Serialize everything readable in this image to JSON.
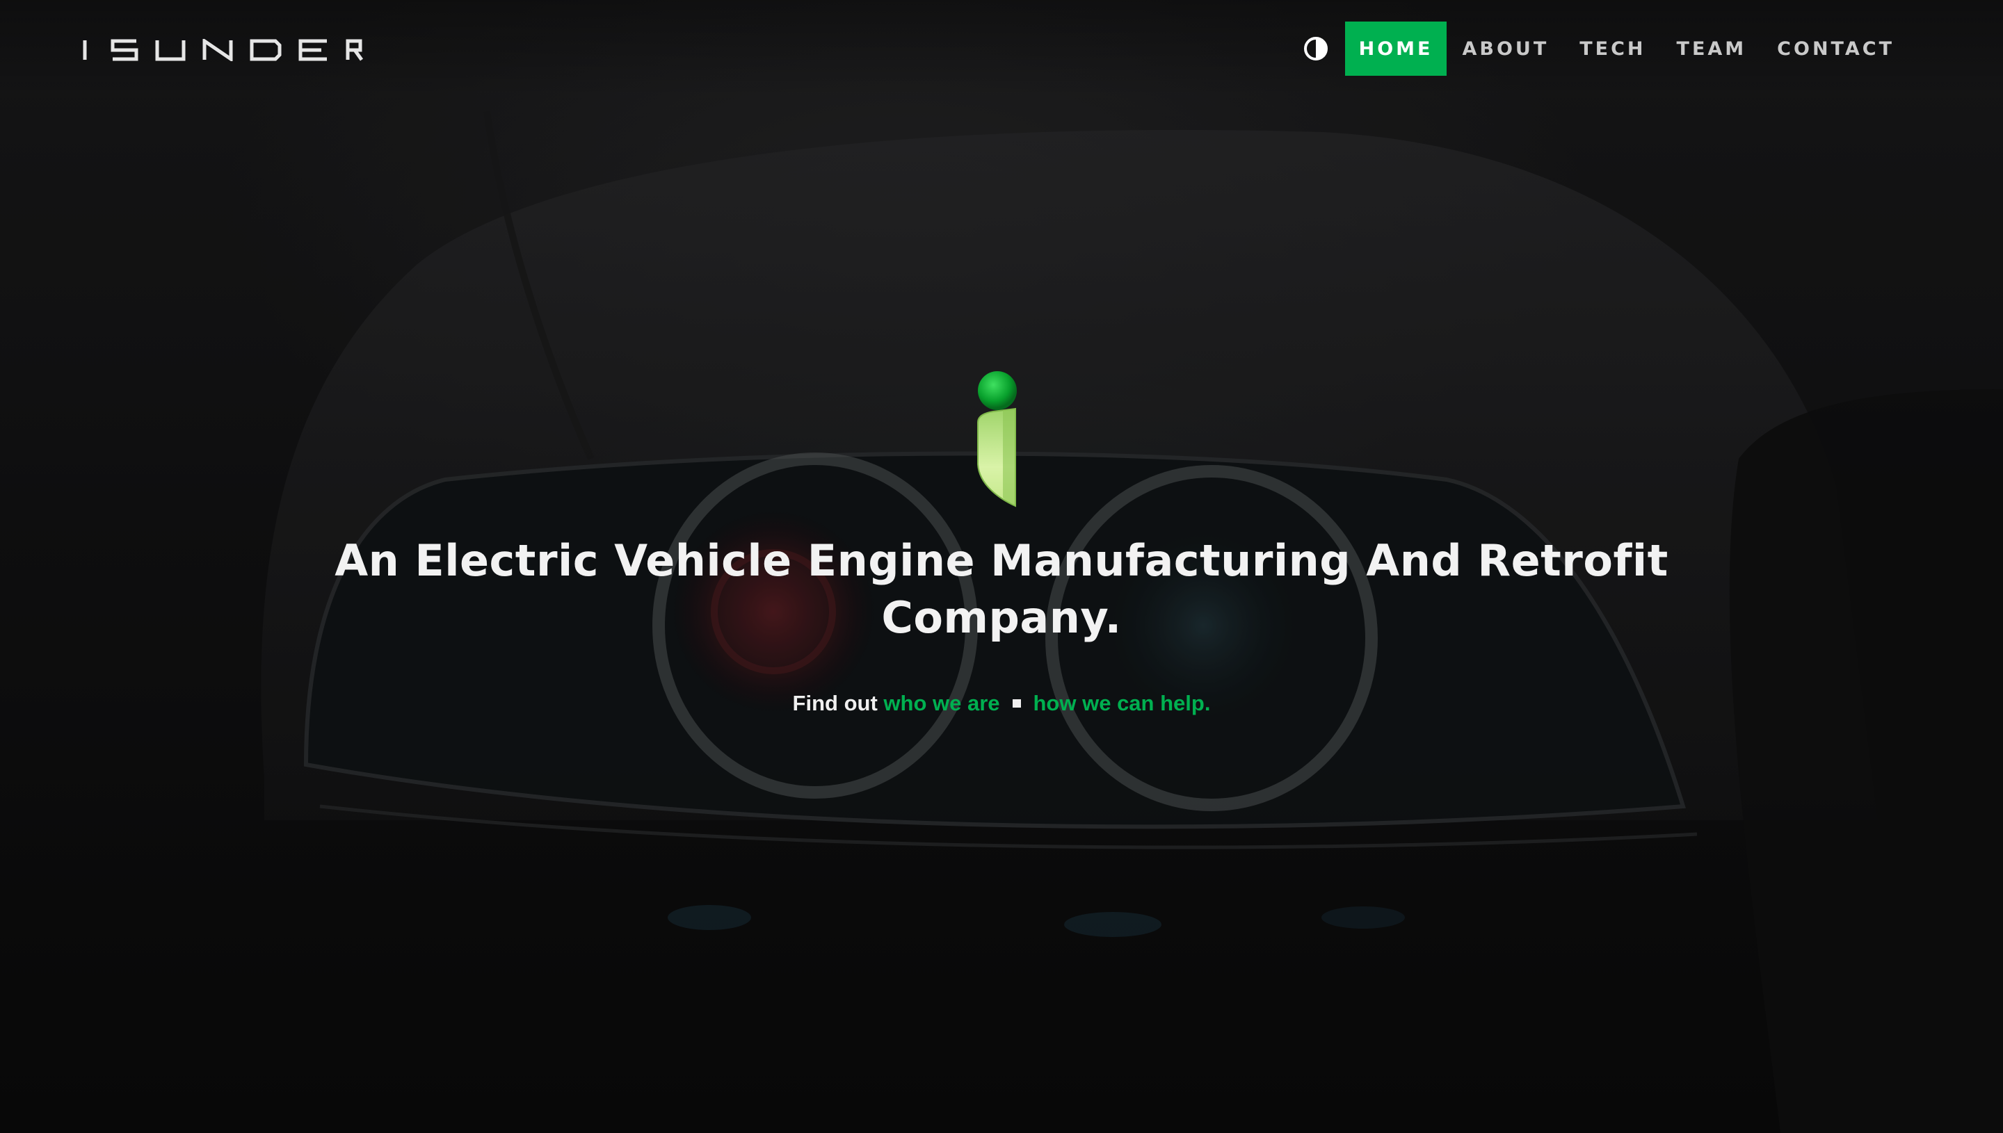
{
  "brand": {
    "logo_text": "ISUNDER",
    "accent_color": "#00b050"
  },
  "nav": {
    "theme_toggle_icon": "contrast-icon",
    "items": [
      {
        "label": "HOME",
        "active": true
      },
      {
        "label": "ABOUT",
        "active": false
      },
      {
        "label": "TECH",
        "active": false
      },
      {
        "label": "TEAM",
        "active": false
      },
      {
        "label": "CONTACT",
        "active": false
      }
    ]
  },
  "hero": {
    "emblem_icon": "isunder-i-emblem-icon",
    "headline": "An Electric Vehicle Engine Manufacturing And Retrofit Company.",
    "subline_prefix": "Find out ",
    "link_who": "who we are",
    "link_how": "how we can help."
  }
}
